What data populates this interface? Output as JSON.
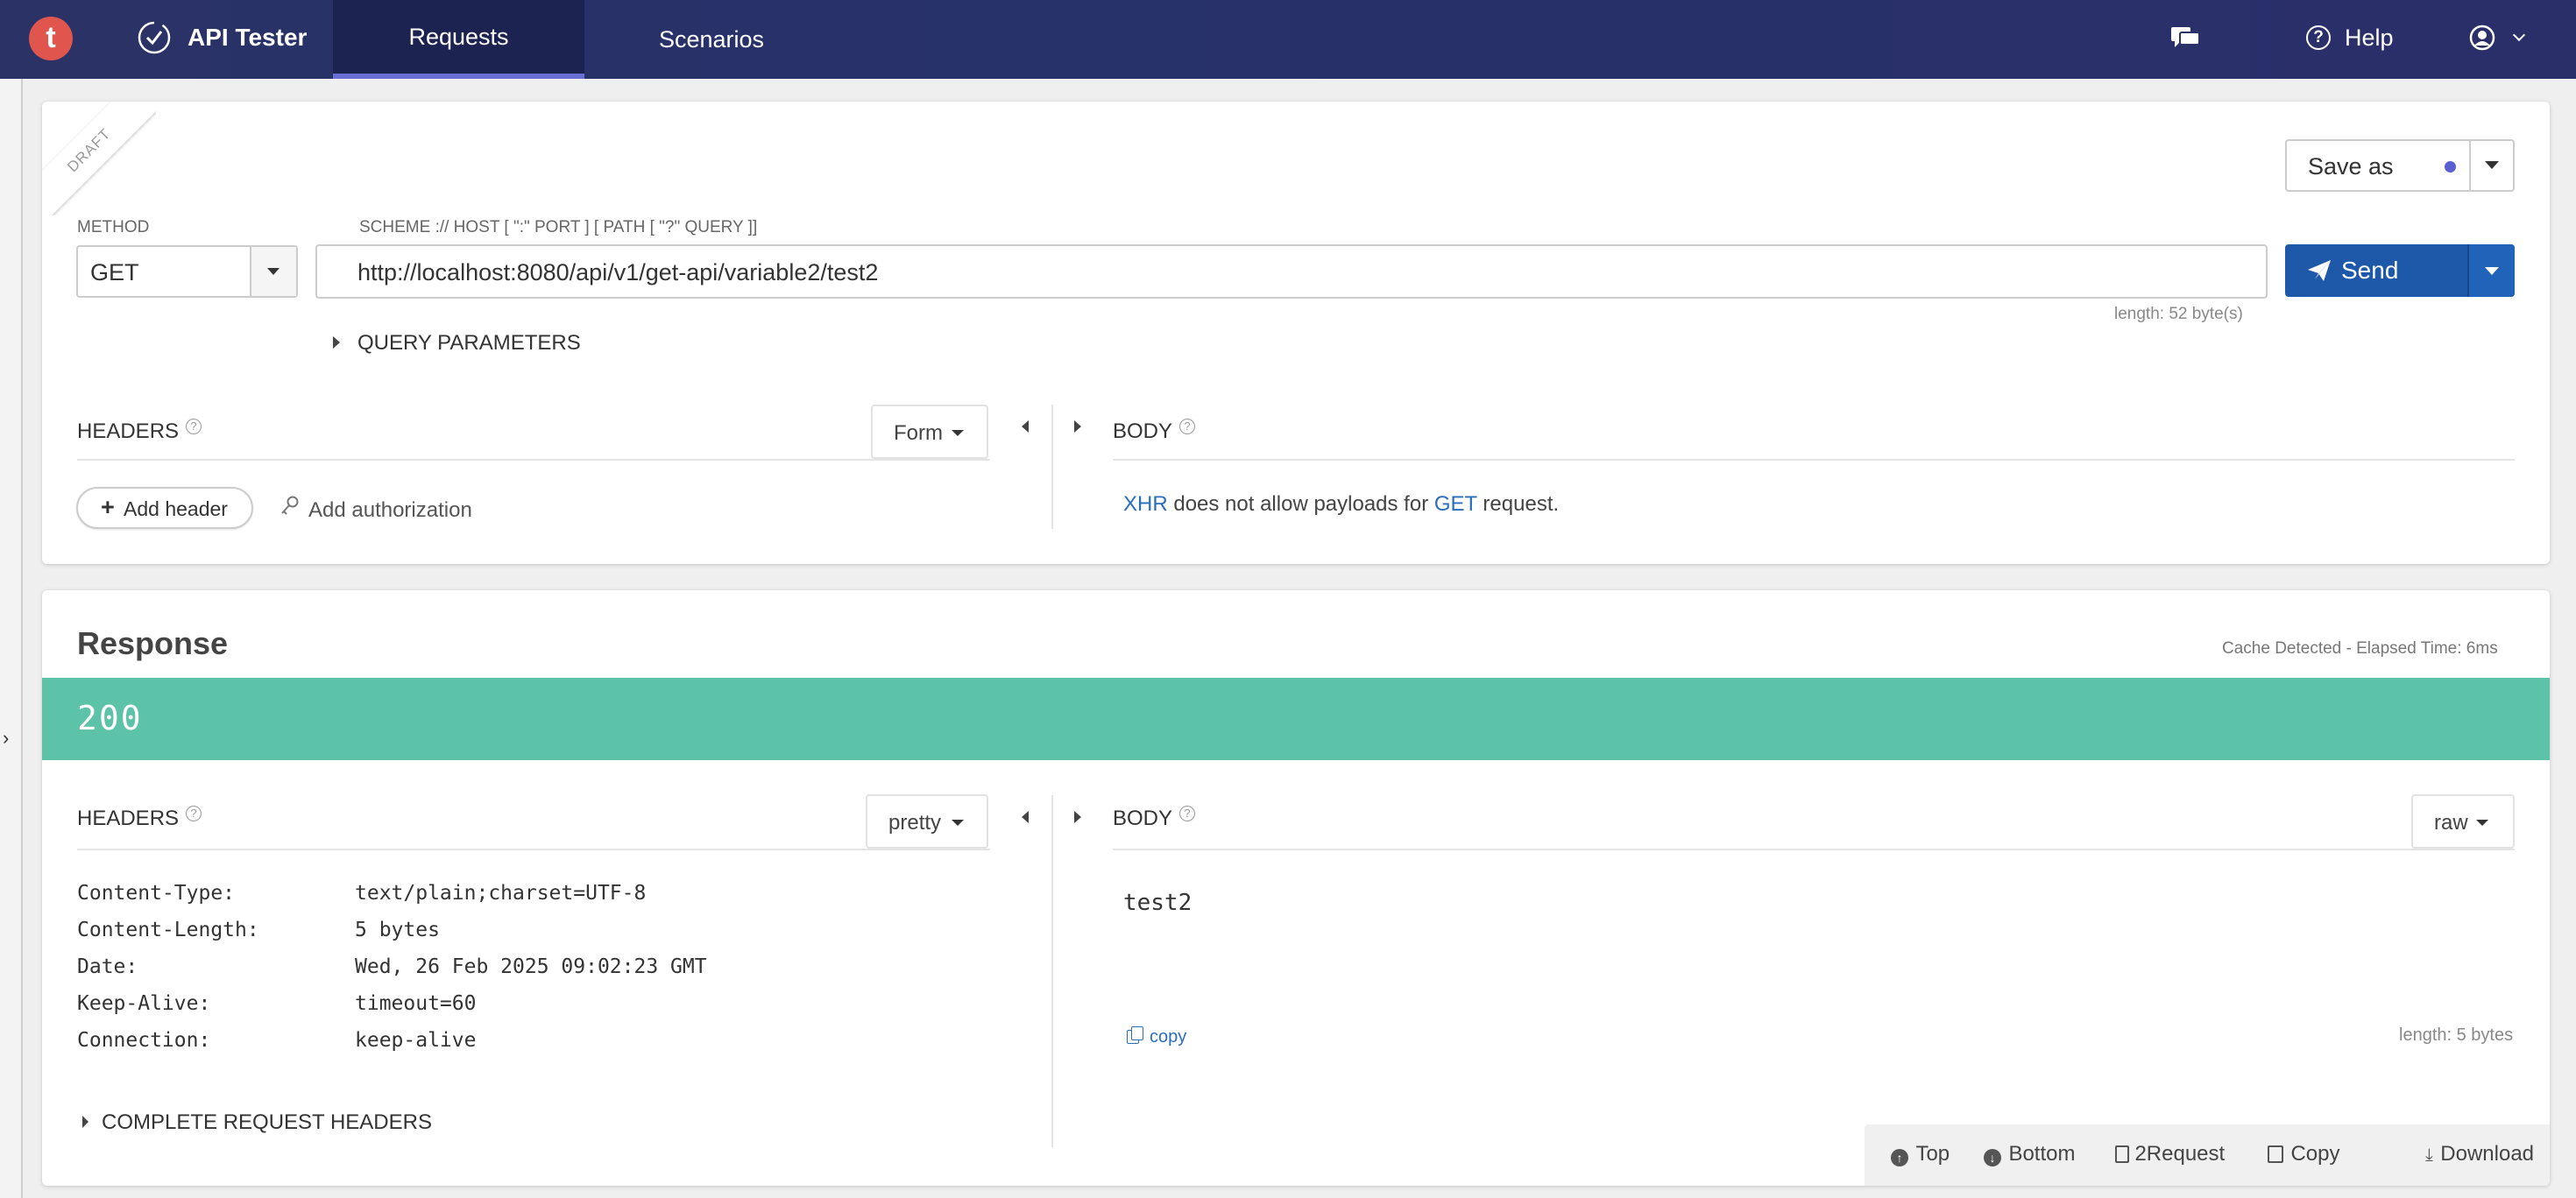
{
  "app": {
    "logo_letter": "t",
    "name": "API Tester",
    "tabs": [
      "Requests",
      "Scenarios"
    ],
    "active_tab": "Requests",
    "help_label": "Help"
  },
  "request": {
    "draft_label": "DRAFT",
    "save_as_label": "Save as",
    "method_label": "METHOD",
    "method_value": "GET",
    "url_hint": "SCHEME :// HOST [ \":\" PORT ] [ PATH [ \"?\" QUERY ]]",
    "url_value": "http://localhost:8080/api/v1/get-api/variable2/test2",
    "send_label": "Send",
    "url_length": "length: 52 byte(s)",
    "query_params_label": "QUERY PARAMETERS",
    "headers_label": "HEADERS",
    "headers_mode": "Form",
    "add_header_label": "Add header",
    "add_auth_label": "Add authorization",
    "body_label": "BODY",
    "body_note": {
      "part1": "XHR",
      "part2": " does not allow payloads for ",
      "part3": "GET",
      "part4": " request."
    }
  },
  "response": {
    "title": "Response",
    "meta": "Cache Detected - Elapsed Time: 6ms",
    "status_code": "200",
    "status_color": "#5cc2a8",
    "headers_label": "HEADERS",
    "headers_mode": "pretty",
    "headers": [
      {
        "key": "Content-Type:",
        "value": "text/plain;charset=UTF-8"
      },
      {
        "key": "Content-Length:",
        "value": "5 bytes"
      },
      {
        "key": "Date:",
        "value": "Wed, 26 Feb 2025 09:02:23 GMT"
      },
      {
        "key": "Keep-Alive:",
        "value": "timeout=60"
      },
      {
        "key": "Connection:",
        "value": "keep-alive"
      }
    ],
    "complete_headers_label": "COMPLETE REQUEST HEADERS",
    "body_label": "BODY",
    "body_mode": "raw",
    "body_content": "test2",
    "copy_label": "copy",
    "body_length": "length: 5 bytes"
  },
  "bottom_toolbar": {
    "top": "Top",
    "bottom": "Bottom",
    "to_request": "2Request",
    "copy": "Copy",
    "download": "Download"
  }
}
